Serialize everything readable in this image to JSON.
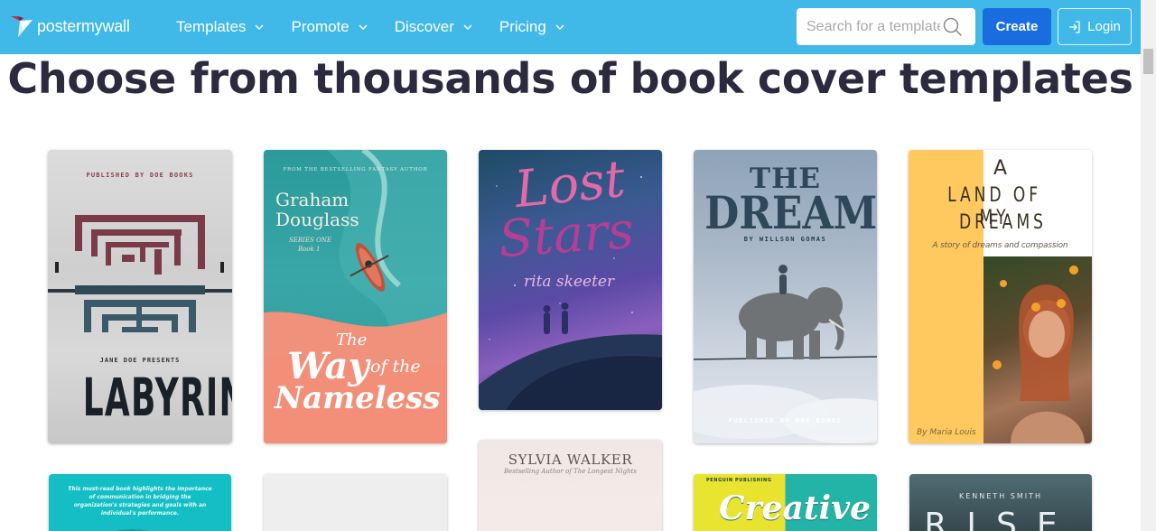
{
  "brand": {
    "logo_text": "postermywall",
    "colors": {
      "header": "#40b8e8",
      "create": "#1a6ddf",
      "title": "#2b2a3f"
    }
  },
  "nav": {
    "items": [
      {
        "label": "Templates",
        "icon": "chevron-down-icon"
      },
      {
        "label": "Promote",
        "icon": "chevron-down-icon"
      },
      {
        "label": "Discover",
        "icon": "chevron-down-icon"
      },
      {
        "label": "Pricing",
        "icon": "chevron-down-icon"
      }
    ]
  },
  "search": {
    "placeholder": "Search for a template",
    "icon": "search-icon"
  },
  "actions": {
    "create_label": "Create",
    "login_label": "Login",
    "login_icon": "login-icon"
  },
  "page": {
    "title": "Choose from thousands of book cover templates"
  },
  "templates": [
    {
      "top": "PUBLISHED BY DOE BOOKS",
      "presenter": "JANE DOE PRESENTS",
      "title": "LABYRINTH"
    },
    {
      "top": "FROM THE BESTSELLING FANTASY AUTHOR",
      "author_1": "Graham",
      "author_2": "Douglass",
      "series_1": "SERIES ONE",
      "series_2": "Book 1",
      "the": "The",
      "way": "Way",
      "of_the": "of the",
      "nameless": "Nameless"
    },
    {
      "title_1": "Lost",
      "title_2": "Stars",
      "author": "rita skeeter"
    },
    {
      "title_1": "THE",
      "title_2": "DREAM",
      "author": "BY WILLSON GOMAS",
      "bottom": "PUBLISHED BY DOE BOOKS"
    },
    {
      "a": "A",
      "line_1": "LAND OF MY",
      "line_2": "DREAMS",
      "subtitle": "A story of dreams and compassion",
      "author": "By Maria Louis"
    },
    {
      "blurb": "This must-read book highlights the importance of communication in bridging the organization's strategies and goals with an individual's performance."
    },
    {},
    {
      "author": "SYLVIA WALKER",
      "subtitle": "Bestselling Author of The Longest Nights"
    },
    {
      "tag": "PENGUIN PUBLISHING",
      "title": "Creative"
    },
    {
      "author": "KENNETH SMITH",
      "title": "RISE"
    }
  ]
}
